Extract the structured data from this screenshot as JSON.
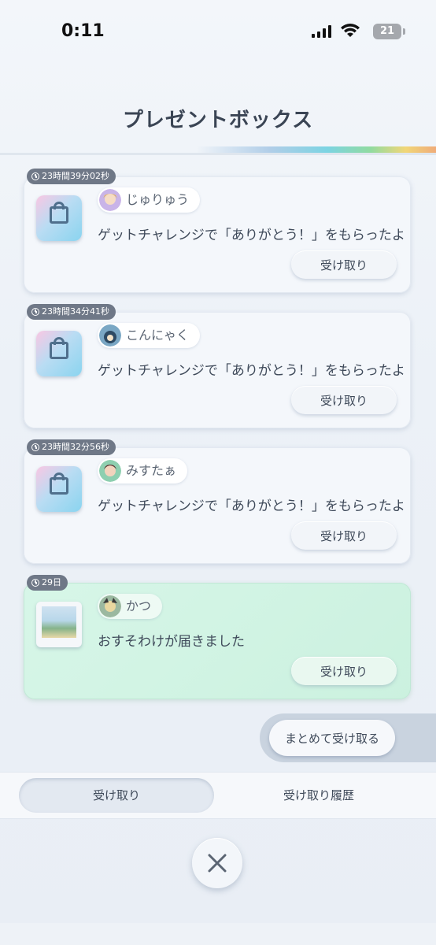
{
  "status_bar": {
    "time": "0:11",
    "battery": "21"
  },
  "header": {
    "title": "プレゼントボックス"
  },
  "presents": [
    {
      "timer": "23時間39分02秒",
      "user": "じゅりゅう",
      "message": "ゲットチャレンジで「ありがとう！」をもらったよ",
      "button": "受け取り",
      "icon": "gift-bag-icon"
    },
    {
      "timer": "23時間34分41秒",
      "user": "こんにゃく",
      "message": "ゲットチャレンジで「ありがとう！」をもらったよ",
      "button": "受け取り",
      "icon": "gift-bag-icon"
    },
    {
      "timer": "23時間32分56秒",
      "user": "みすたぁ",
      "message": "ゲットチャレンジで「ありがとう！」をもらったよ",
      "button": "受け取り",
      "icon": "gift-bag-icon"
    },
    {
      "timer": "29日",
      "user": "かつ",
      "message": "おすそわけが届きました",
      "button": "受け取り",
      "icon": "card-icon"
    }
  ],
  "bulk_button": "まとめて受け取る",
  "tabs": {
    "receive": "受け取り",
    "history": "受け取り履歴"
  },
  "colors": {
    "card": "#f4f7fb",
    "card_green": "#d7f6e8",
    "timer_badge": "#6f7887",
    "text": "#3f4a5a"
  }
}
